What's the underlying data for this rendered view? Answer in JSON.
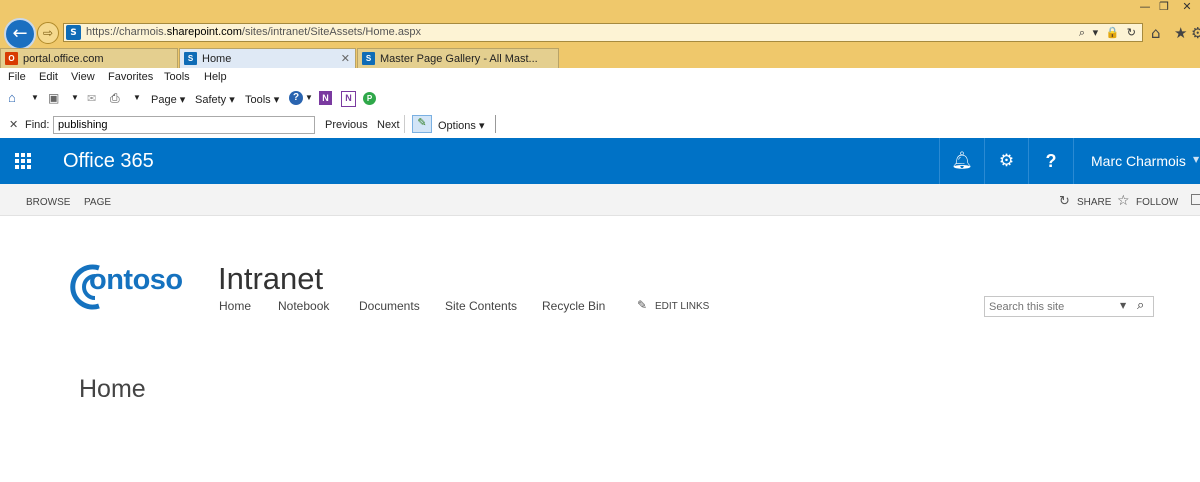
{
  "browser": {
    "address": {
      "prefix": "https://charmois.",
      "domain": "sharepoint.com",
      "path": "/sites/intranet/SiteAssets/Home.aspx"
    },
    "address_tools": "⌕ ▾ 🔒 ↻",
    "tabs": [
      {
        "label": "portal.office.com"
      },
      {
        "label": "Home"
      },
      {
        "label": "Master Page Gallery - All Mast..."
      }
    ],
    "menu": [
      "File",
      "Edit",
      "View",
      "Favorites",
      "Tools",
      "Help"
    ],
    "command_bar": {
      "page": "Page",
      "safety": "Safety",
      "tools": "Tools"
    },
    "find": {
      "label": "Find:",
      "value": "publishing",
      "previous": "Previous",
      "next": "Next",
      "options": "Options"
    },
    "colors": {
      "chrome": "#efc86b",
      "address_bg": "#fdf3d4",
      "accent": "#1a6fc0"
    }
  },
  "suite": {
    "title": "Office 365",
    "user": "Marc Charmois",
    "icons": [
      "app-launcher-icon",
      "bell-icon",
      "gear-icon",
      "help-icon"
    ],
    "color": "#0072c6"
  },
  "ribbon": {
    "browse": "BROWSE",
    "page": "PAGE",
    "share": "SHARE",
    "follow": "FOLLOW"
  },
  "site": {
    "logo_text": "ontoso",
    "title": "Intranet",
    "nav": [
      "Home",
      "Notebook",
      "Documents",
      "Site Contents",
      "Recycle Bin"
    ],
    "edit_links": "EDIT LINKS",
    "search_placeholder": "Search this site",
    "page_title": "Home"
  }
}
